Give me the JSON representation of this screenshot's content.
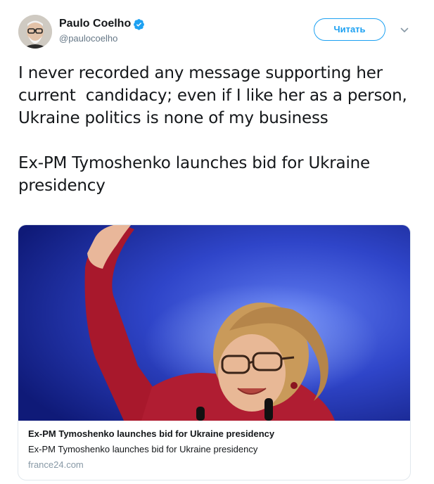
{
  "author": {
    "display_name": "Paulo Coelho",
    "handle": "@paulocoelho",
    "verified": true,
    "avatar_icon": "person-avatar-icon",
    "verified_icon": "verified-badge-icon"
  },
  "actions": {
    "follow_label": "Читать",
    "menu_icon": "chevron-down-icon"
  },
  "tweet": {
    "paragraphs": [
      "I never recorded any message supporting her current  candidacy; even if I like her as a person, Ukraine politics is none of my business",
      "Ex-PM Tymoshenko launches bid for Ukraine presidency"
    ]
  },
  "card": {
    "image_icon": "news-photo",
    "title": "Ex-PM Tymoshenko launches bid for Ukraine presidency",
    "description": "Ex-PM Tymoshenko launches bid for Ukraine presidency",
    "domain": "france24.com"
  },
  "colors": {
    "accent": "#1da1f2",
    "text": "#14171a",
    "secondary": "#657786",
    "card_border": "#e1e8ed"
  }
}
